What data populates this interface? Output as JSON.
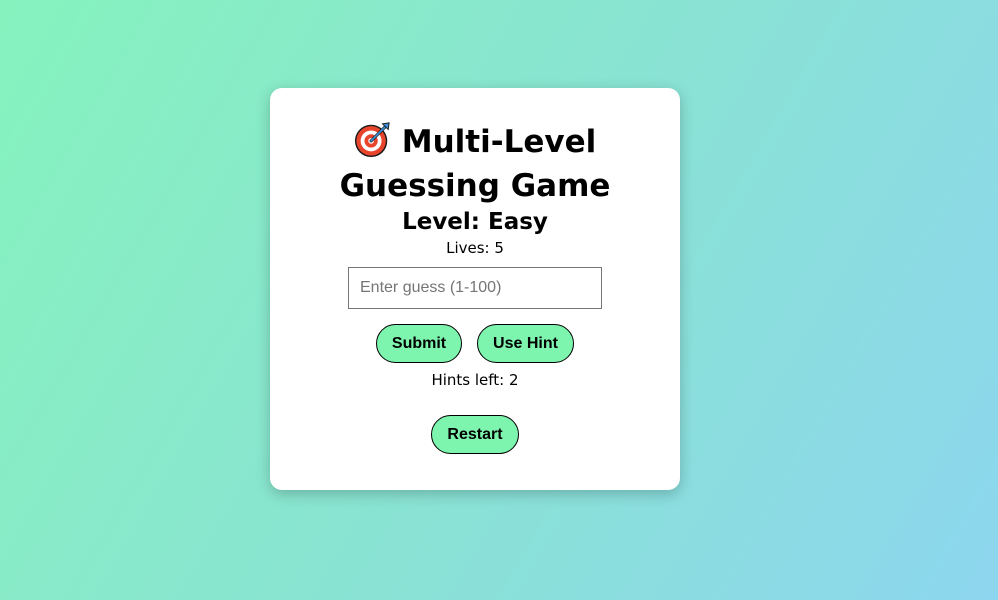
{
  "game": {
    "title_line1": "Multi-Level",
    "title_line2": "Guessing Game",
    "title_icon": "target-dart-icon",
    "level_text": "Level: Easy",
    "lives_text": "Lives: 5",
    "guess_placeholder": "Enter guess (1-100)",
    "guess_value": "",
    "submit_label": "Submit",
    "hint_label": "Use Hint",
    "hints_left_text": "Hints left: 2",
    "restart_label": "Restart"
  },
  "colors": {
    "button_bg": "#7ef5ae",
    "card_bg": "#ffffff",
    "gradient_start": "#86f3be",
    "gradient_end": "#8dd6ef"
  }
}
